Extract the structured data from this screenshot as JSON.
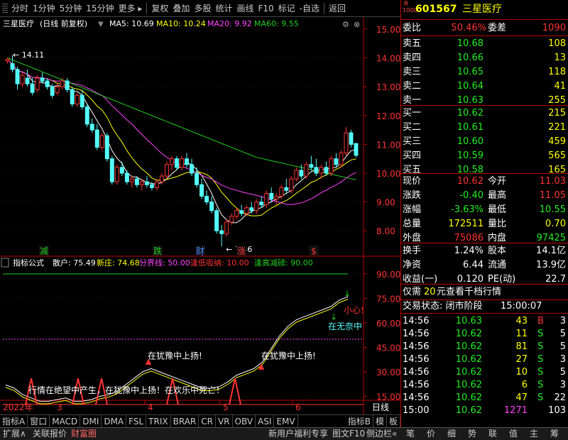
{
  "toolbar": {
    "items": [
      "分时",
      "1分钟",
      "5分钟",
      "15分钟",
      "更多",
      "复权",
      "叠加",
      "多股",
      "统计",
      "画线",
      "F10",
      "标记",
      "-自选",
      "返回"
    ]
  },
  "main_chart": {
    "title": "三星医疗",
    "subtitle": "(日线 前复权)",
    "ma5": "MA5: 10.69",
    "ma10": "MA10: 10.24",
    "ma20": "MA20: 9.92",
    "ma60": "MA60: 9.55",
    "price_axis": [
      "15.00",
      "14.00",
      "13.00",
      "12.00",
      "11.00",
      "10.00",
      "9.00",
      "8.00"
    ],
    "high_label": "14.11",
    "low_label": "7.46",
    "markers": [
      "减",
      "跌",
      "财",
      "涨",
      "$"
    ]
  },
  "indicator": {
    "name": "指标公式",
    "legend": [
      {
        "text": "散户: 75.49",
        "color": "#ffffff"
      },
      {
        "text": "新庄: 74.68",
        "color": "#ffff00"
      },
      {
        "text": "分界线: 50.00",
        "color": "#ff44ff"
      },
      {
        "text": "逢低吸纳: 10.00",
        "color": "#ff3333"
      },
      {
        "text": "逢高减磅: 90.00",
        "color": "#22cc22"
      }
    ],
    "axis": [
      "90.00",
      "75.00",
      "60.00",
      "45.00",
      "30.00",
      "15.00"
    ],
    "annotations": {
      "despair": "行情在绝望中产生，在犹豫中上扬！在欢乐中死亡！",
      "hesitate1": "在犹豫中上扬!",
      "hesitate2": "在犹豫中上扬!",
      "careful": "小心!",
      "joy": "在无奈中"
    }
  },
  "date_axis": {
    "year": "2022年",
    "months": [
      "3",
      "4",
      "5",
      "6"
    ],
    "right_label": "日线"
  },
  "bottom_tabs": [
    "指标A",
    "窗口",
    "MACD",
    "DMI",
    "DMA",
    "FSL",
    "TRIX",
    "BRAR",
    "CR",
    "VR",
    "OBV",
    "ASI",
    "EMV",
    "指标B",
    "模",
    "板"
  ],
  "stock": {
    "code": "601567",
    "name": "三星医疗",
    "badge": "R"
  },
  "order_book": {
    "weibi_label": "委比",
    "weibi_value": "50.46%",
    "weicha_label": "委差",
    "weicha_value": "1090",
    "asks": [
      {
        "label": "卖五",
        "price": "10.68",
        "vol": "108"
      },
      {
        "label": "卖四",
        "price": "10.66",
        "vol": "13"
      },
      {
        "label": "卖三",
        "price": "10.65",
        "vol": "118"
      },
      {
        "label": "卖二",
        "price": "10.64",
        "vol": "41"
      },
      {
        "label": "卖一",
        "price": "10.63",
        "vol": "255"
      }
    ],
    "bids": [
      {
        "label": "买一",
        "price": "10.62",
        "vol": "215"
      },
      {
        "label": "买二",
        "price": "10.61",
        "vol": "221"
      },
      {
        "label": "买三",
        "price": "10.60",
        "vol": "459"
      },
      {
        "label": "买四",
        "price": "10.59",
        "vol": "565"
      },
      {
        "label": "买五",
        "price": "10.58",
        "vol": "165"
      }
    ]
  },
  "quote": {
    "rows": [
      {
        "l1": "现价",
        "v1": "10.62",
        "c1": "#ff3333",
        "l2": "今开",
        "v2": "11.03",
        "c2": "#ff3333"
      },
      {
        "l1": "涨跌",
        "v1": "-0.40",
        "c1": "#22ee22",
        "l2": "最高",
        "v2": "11.05",
        "c2": "#ff3333"
      },
      {
        "l1": "涨幅",
        "v1": "-3.63%",
        "c1": "#22ee22",
        "l2": "最低",
        "v2": "10.55",
        "c2": "#22ee22"
      },
      {
        "l1": "总量",
        "v1": "172511",
        "c1": "#ffff00",
        "l2": "量比",
        "v2": "0.70",
        "c2": "#ffff00"
      },
      {
        "l1": "外盘",
        "v1": "75086",
        "c1": "#ff3333",
        "l2": "内盘",
        "v2": "97425",
        "c2": "#22ee22"
      }
    ],
    "rows2": [
      {
        "l1": "换手",
        "v1": "1.24%",
        "l2": "股本",
        "v2": "14.1亿"
      },
      {
        "l1": "净资",
        "v1": "6.44",
        "l2": "流通",
        "v2": "13.9亿"
      },
      {
        "l1": "收益(一)",
        "v1": "0.120",
        "l2": "PE(动)",
        "v2": "22.7"
      }
    ]
  },
  "promo": {
    "text_pre": "仅需",
    "text_num": "20",
    "text_post": "元查看千档行情"
  },
  "trade_status": {
    "label": "交易状态: 闭市阶段",
    "time": "15:00:07"
  },
  "ticks": [
    {
      "time": "14:56",
      "price": "10.63",
      "vol": "43",
      "flag": "B",
      "n": "3"
    },
    {
      "time": "14:56",
      "price": "10.62",
      "vol": "11",
      "flag": "S",
      "n": "5"
    },
    {
      "time": "14:56",
      "price": "10.62",
      "vol": "81",
      "flag": "S",
      "n": "5"
    },
    {
      "time": "14:56",
      "price": "10.62",
      "vol": "27",
      "flag": "S",
      "n": "3"
    },
    {
      "time": "14:56",
      "price": "10.62",
      "vol": "10",
      "flag": "S",
      "n": "5"
    },
    {
      "time": "14:56",
      "price": "10.62",
      "vol": "6",
      "flag": "S",
      "n": "3"
    },
    {
      "time": "14:56",
      "price": "10.62",
      "vol": "47",
      "flag": "S",
      "n": "22"
    },
    {
      "time": "15:00",
      "price": "10.62",
      "vol": "1271",
      "flag": "",
      "n": "103"
    }
  ],
  "status_bar": {
    "left": [
      "扩展∧",
      "关联报价",
      "财富圈"
    ],
    "mid": [
      "新用户福利专享",
      "图文F10",
      "侧边栏«"
    ],
    "right": [
      "笔",
      "价",
      "细",
      "势",
      "联",
      "值",
      "主",
      "筹"
    ]
  }
}
